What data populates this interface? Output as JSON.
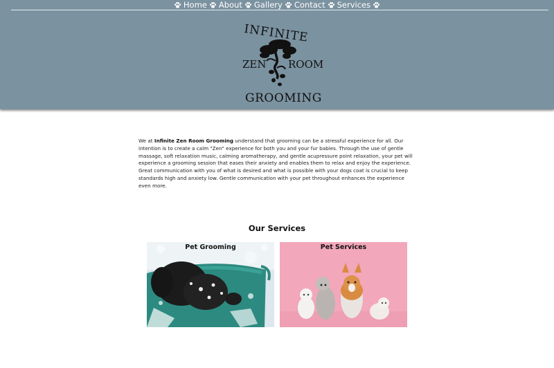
{
  "nav": {
    "items": [
      {
        "label": "Home"
      },
      {
        "label": "About"
      },
      {
        "label": "Gallery"
      },
      {
        "label": "Contact"
      },
      {
        "label": "Services"
      }
    ],
    "icon": "paw-icon"
  },
  "logo": {
    "line1": "INFINITE",
    "left": "ZEN",
    "right": "ROOM",
    "line3": "GROOMING",
    "icon": "bonsai-tree-icon"
  },
  "intro": {
    "prefix": "We at ",
    "business": "Infinite Zen Room Grooming",
    "text": " understand that grooming can be a stressful experience for all. Our intention is to create a calm \"Zen\" experience for both you and your fur babies. Through the use of gentle massage, soft relaxation music, calming aromatherapy, and gentle acupressure point relaxation, your pet will experience a grooming session that eases their anxiety and enables them to relax and enjoy the experience. Great communication with you of what is desired and what is possible with your dogs coat is crucial to keep standards high and anxiety low. Gentle communication with your pet throughout enhances the experience even more."
  },
  "services": {
    "title": "Our Services",
    "cards": [
      {
        "title": "Pet Grooming"
      },
      {
        "title": "Pet Services"
      }
    ]
  },
  "colors": {
    "header_bg": "#7b92a0",
    "page_bg": "#ffffff",
    "pink_bg": "#f2a8bb"
  }
}
